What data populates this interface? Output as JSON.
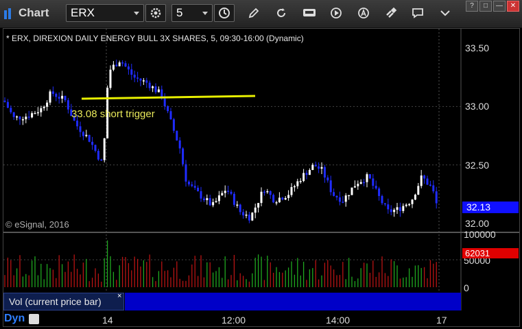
{
  "titlebar": {
    "app_title": "Chart",
    "symbol": "ERX",
    "interval": "5",
    "window_buttons": [
      "?",
      "□",
      "—",
      "✕"
    ],
    "toolbar_icons": [
      "gear-icon",
      "clock-icon",
      "pencil-icon",
      "refresh-icon",
      "get-icon",
      "play-icon",
      "a-icon",
      "link-icon",
      "comment-icon"
    ]
  },
  "chart": {
    "symbol_description": "* ERX, DIREXION DAILY ENERGY BULL 3X SHARES, 5, 09:30-16:00 (Dynamic)",
    "annotation": "33.08 short trigger",
    "copyright": "© eSignal, 2016",
    "price_axis": [
      "33.50",
      "33.00",
      "32.50",
      "32.00"
    ],
    "last_price": "32.13",
    "volume_axis": [
      "100000",
      "50000",
      "0"
    ],
    "last_volume": "62031",
    "volume_panel_label": "Vol (current price bar)",
    "volume_panel_close": "×",
    "time_axis": [
      "14",
      "12:00",
      "14:00",
      "17"
    ],
    "bottom_mode": "Dyn",
    "trigger_level": 33.08,
    "colors": {
      "up": "#ffffff",
      "down": "#1f2cff",
      "trigger": "#e8f000",
      "vol_up": "#1fa81f",
      "vol_down": "#b81414"
    }
  }
}
